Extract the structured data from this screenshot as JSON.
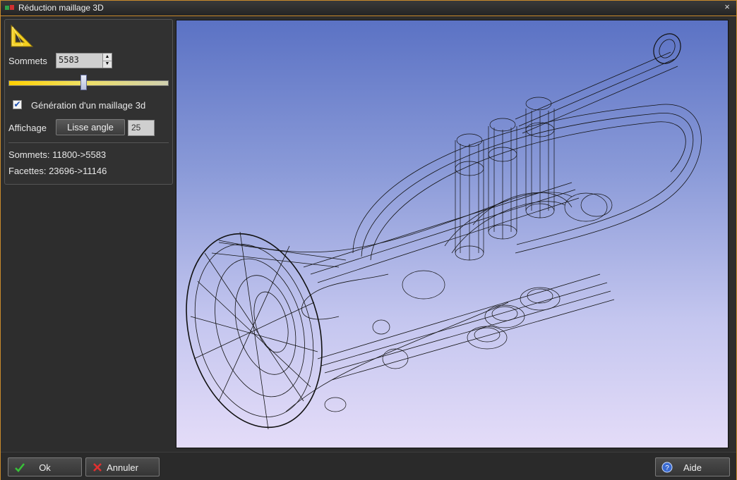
{
  "window": {
    "title": "Réduction maillage 3D",
    "close_label": "×"
  },
  "panel": {
    "sommets_label": "Sommets",
    "sommets_value": "5583",
    "slider_fraction": 0.47,
    "checkbox_label": "Génération d'un maillage 3d",
    "checkbox_checked": true,
    "affichage_label": "Affichage",
    "lisse_button_label": "Lisse angle",
    "angle_value": "25",
    "stats_sommets": "Sommets: 11800->5583",
    "stats_facettes": "Facettes: 23696->11146"
  },
  "buttons": {
    "ok_label": "Ok",
    "annuler_label": "Annuler",
    "aide_label": "Aide"
  },
  "icons": {
    "app": "app-mesh-icon",
    "tool": "set-square-icon",
    "ok": "check-icon",
    "annuler": "cross-icon",
    "aide": "help-icon"
  },
  "colors": {
    "accent_border": "#c98a2c",
    "viewport_top": "#5b72c4",
    "viewport_bottom": "#e4dcf8"
  }
}
